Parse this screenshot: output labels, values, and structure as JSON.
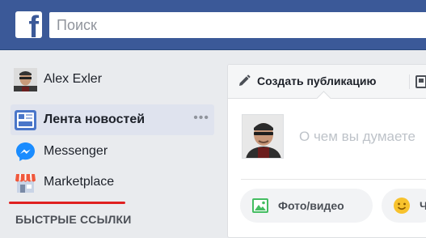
{
  "header": {
    "logo_text": "f",
    "search": {
      "placeholder": "Поиск"
    }
  },
  "sidebar": {
    "profile": {
      "name": "Alex Exler"
    },
    "items": [
      {
        "label": "Лента новостей",
        "icon": "news-feed-icon",
        "active": true,
        "more": "•••"
      },
      {
        "label": "Messenger",
        "icon": "messenger-icon"
      },
      {
        "label": "Marketplace",
        "icon": "marketplace-icon"
      }
    ],
    "section_title": "БЫСТРЫЕ ССЫЛКИ"
  },
  "composer": {
    "create_tab_label": "Создать публикацию",
    "prompt": "О чем вы думаете",
    "actions": [
      {
        "label": "Фото/видео",
        "icon": "photo-icon"
      },
      {
        "label": "Чувства",
        "icon": "smiley-icon"
      }
    ]
  },
  "colors": {
    "topbar": "#3b5998",
    "active_item_bg": "#dfe3ee",
    "annotation_underline": "#e02020"
  }
}
